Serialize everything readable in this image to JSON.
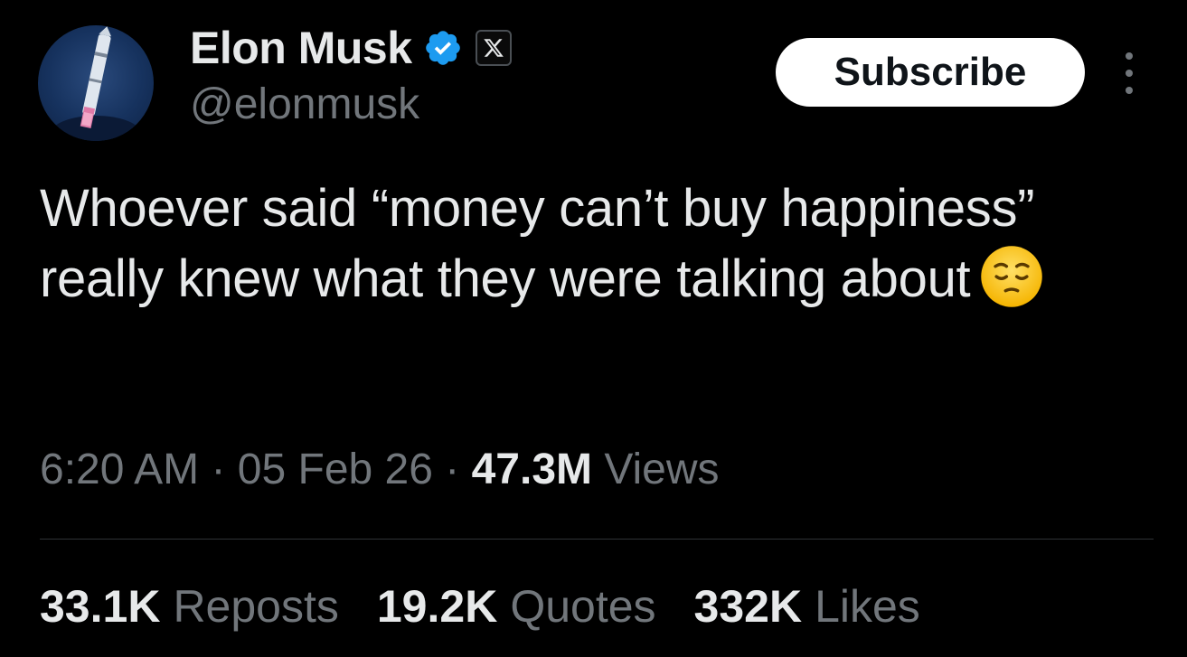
{
  "author": {
    "display_name": "Elon Musk",
    "handle": "@elonmusk",
    "verified_icon": "verified-badge-icon",
    "affiliate_icon": "x-logo-icon",
    "avatar_icon": "rocket-avatar"
  },
  "header": {
    "subscribe_label": "Subscribe",
    "more_icon": "more-vertical-icon"
  },
  "tweet": {
    "text": "Whoever said “money can’t buy happiness” really knew what they were talking about",
    "emoji": "pensive-face-emoji"
  },
  "meta": {
    "time": "6:20 AM",
    "sep1": " · ",
    "date": "05 Feb 26",
    "sep2": " · ",
    "views_count": "47.3M",
    "views_label": " Views"
  },
  "stats": {
    "reposts_count": "33.1K",
    "reposts_label": "Reposts",
    "quotes_count": "19.2K",
    "quotes_label": "Quotes",
    "likes_count": "332K",
    "likes_label": "Likes"
  },
  "colors": {
    "background": "#000000",
    "text_primary": "#e7e9ea",
    "text_secondary": "#71767b",
    "verified_blue": "#1d9bf0",
    "divider": "#2f3336"
  }
}
